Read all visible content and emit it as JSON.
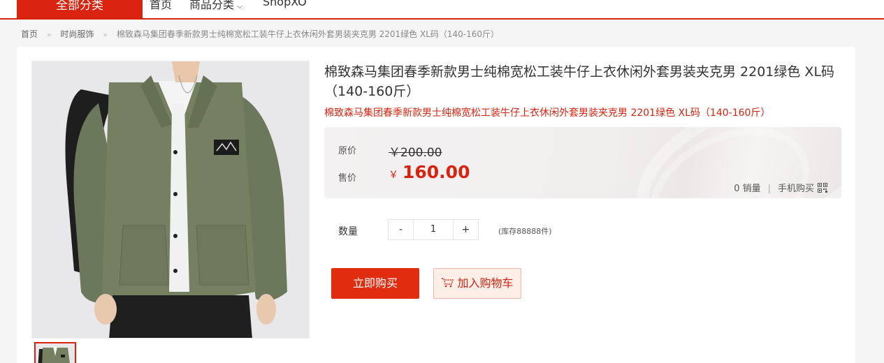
{
  "nav": {
    "all_categories": "全部分类",
    "home": "首页",
    "product_categories": "商品分类",
    "brand": "ShopXO"
  },
  "breadcrumb": {
    "home": "首页",
    "category": "时尚服饰",
    "current": "棉致森马集团春季新款男士纯棉宽松工装牛仔上衣休闲外套男装夹克男 2201绿色 XL码（140-160斤）"
  },
  "product": {
    "title": "棉致森马集团春季新款男士纯棉宽松工装牛仔上衣休闲外套男装夹克男 2201绿色 XL码（140-160斤）",
    "subtitle": "棉致森马集团春季新款男士纯棉宽松工装牛仔上衣休闲外套男装夹克男 2201绿色 XL码（140-160斤）",
    "original_price_label": "原价",
    "original_price": "￥200.00",
    "sale_price_label": "售价",
    "currency": "￥",
    "sale_price": "160.00",
    "sales_count": "0 销量",
    "mobile_buy": "手机购买",
    "quantity_label": "数量",
    "quantity": "1",
    "minus": "-",
    "plus": "+",
    "stock": "(库存88888件)",
    "buy_now": "立即购买",
    "add_to_cart": "加入购物车"
  },
  "colors": {
    "accent": "#d9230f",
    "jacket": "#6e7a5e"
  }
}
